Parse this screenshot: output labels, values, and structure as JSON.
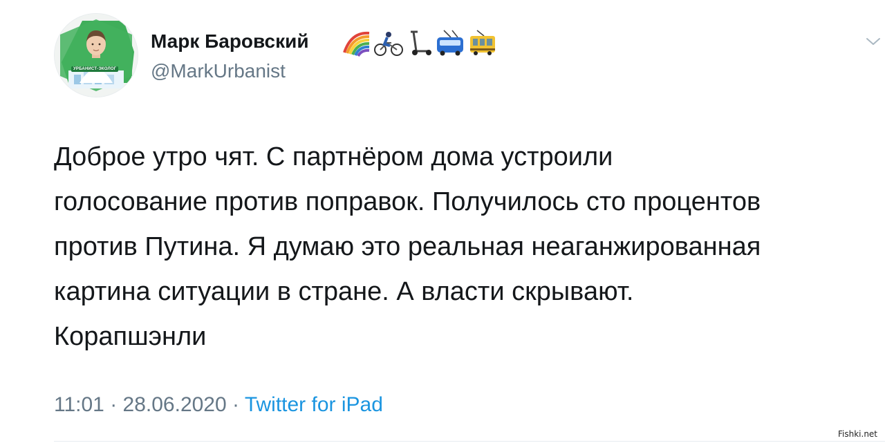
{
  "tweet": {
    "author": {
      "display_name": "Марк Баровский",
      "name_emojis": [
        "rainbow-icon",
        "cyclist-icon",
        "kick-scooter-icon",
        "trolleybus-icon",
        "tram-icon"
      ],
      "handle": "@MarkUrbanist",
      "avatar_badge": "УРБАНИСТ-ЭКОЛОГ"
    },
    "text": "Доброе утро чят. С партнёром дома устроили\nголосование против поправок. Получилось сто процентов\nпротив Путина. Я думаю это реальная неаганжированная\nкартина ситуации в стране. А власти скрывают.\nКорапшэнли",
    "time": "11:01",
    "separator": " · ",
    "date": "28.06.2020",
    "source": "Twitter for iPad"
  },
  "watermark": "Fishki.net",
  "colors": {
    "text": "#14171a",
    "secondary": "#657786",
    "link": "#1b95e0",
    "avatar_green": "#3fae5a"
  }
}
